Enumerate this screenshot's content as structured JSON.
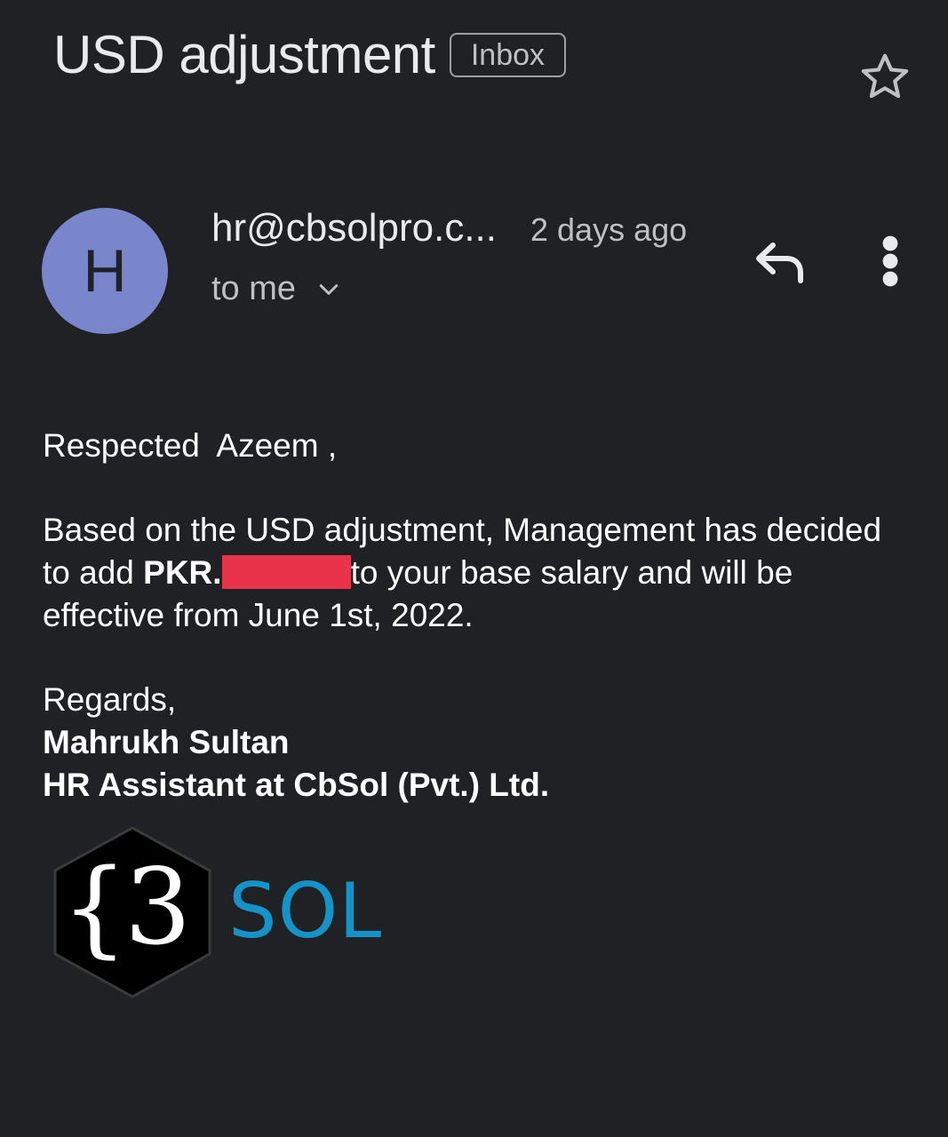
{
  "header": {
    "subject": "USD adjustment",
    "label": "Inbox",
    "star_icon": "star-outline-icon"
  },
  "message": {
    "avatar_letter": "H",
    "avatar_color": "#7986cb",
    "sender": "hr@cbsolpro.c...",
    "time": "2 days ago",
    "recipient": "to me",
    "reply_icon": "reply-icon",
    "more_icon": "more-vert-icon",
    "chevron_icon": "chevron-down-icon"
  },
  "body": {
    "greeting": "Respected  Azeem ,",
    "para_part1": "Based on the USD adjustment, Management has decided to add ",
    "currency": "PKR.",
    "para_part2": "to your base salary and will be effective from June 1st, 2022.",
    "closing": "Regards,",
    "signature_name": "Mahrukh Sultan",
    "signature_title": "HR Assistant at CbSol (Pvt.) Ltd."
  },
  "logo": {
    "mark": "{3",
    "word": "SOL",
    "word_color": "#1592c8"
  }
}
